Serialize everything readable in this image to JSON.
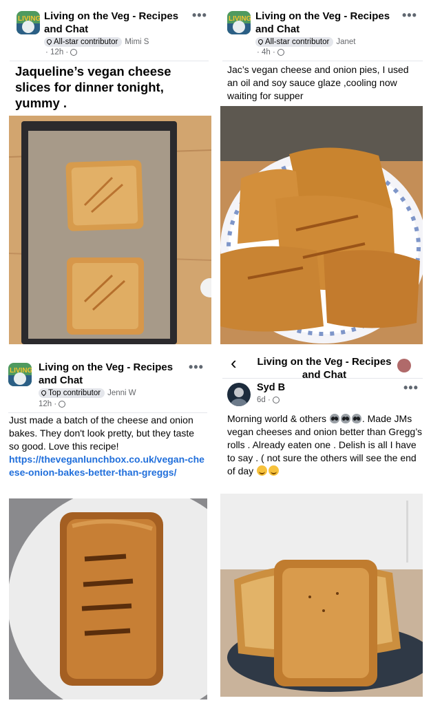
{
  "posts": [
    {
      "group": "Living on the Veg - Recipes and Chat",
      "badge": "All-star contributor",
      "author": "Mimi S",
      "time": "· 12h ·",
      "caption": "Jaqueline’s vegan cheese slices for dinner tonight, yummy ."
    },
    {
      "group": "Living on the Veg - Recipes and Chat",
      "badge": "All-star contributor",
      "author": "Janet",
      "time": "· 4h ·",
      "caption": "Jac’s vegan cheese and onion pies, I used an oil and soy sauce glaze ,cooling now waiting for supper"
    },
    {
      "group": "Living on the Veg - Recipes and Chat",
      "badge": "Top contributor",
      "author": "Jenni W",
      "time": "12h ·",
      "caption": "Just made a batch of the cheese and onion bakes. They don't look pretty, but they taste so good. Love this recipe!",
      "link": "https://theveganlunchbox.co.uk/vegan-cheese-onion-bakes-better-than-greggs/"
    },
    {
      "group": "Living on the Veg - Recipes and Chat",
      "back": "‹",
      "author": "Syd B",
      "time": "6d ·",
      "caption_a": "Morning world & others",
      "caption_b": ". Made JMs vegan cheeses and onion better than Gregg’s rolls . Already eaten one . Delish is all I have to say . ( not sure the others will see the end of day"
    }
  ],
  "menu_icon": "more-dots-icon",
  "icons": {
    "privacy": "globe-icon",
    "badge": "award-pin-icon",
    "back": "back-chevron-icon"
  },
  "colors": {
    "link": "#216fdb",
    "badge_bg": "#e4e6eb",
    "meta": "#65676b"
  }
}
